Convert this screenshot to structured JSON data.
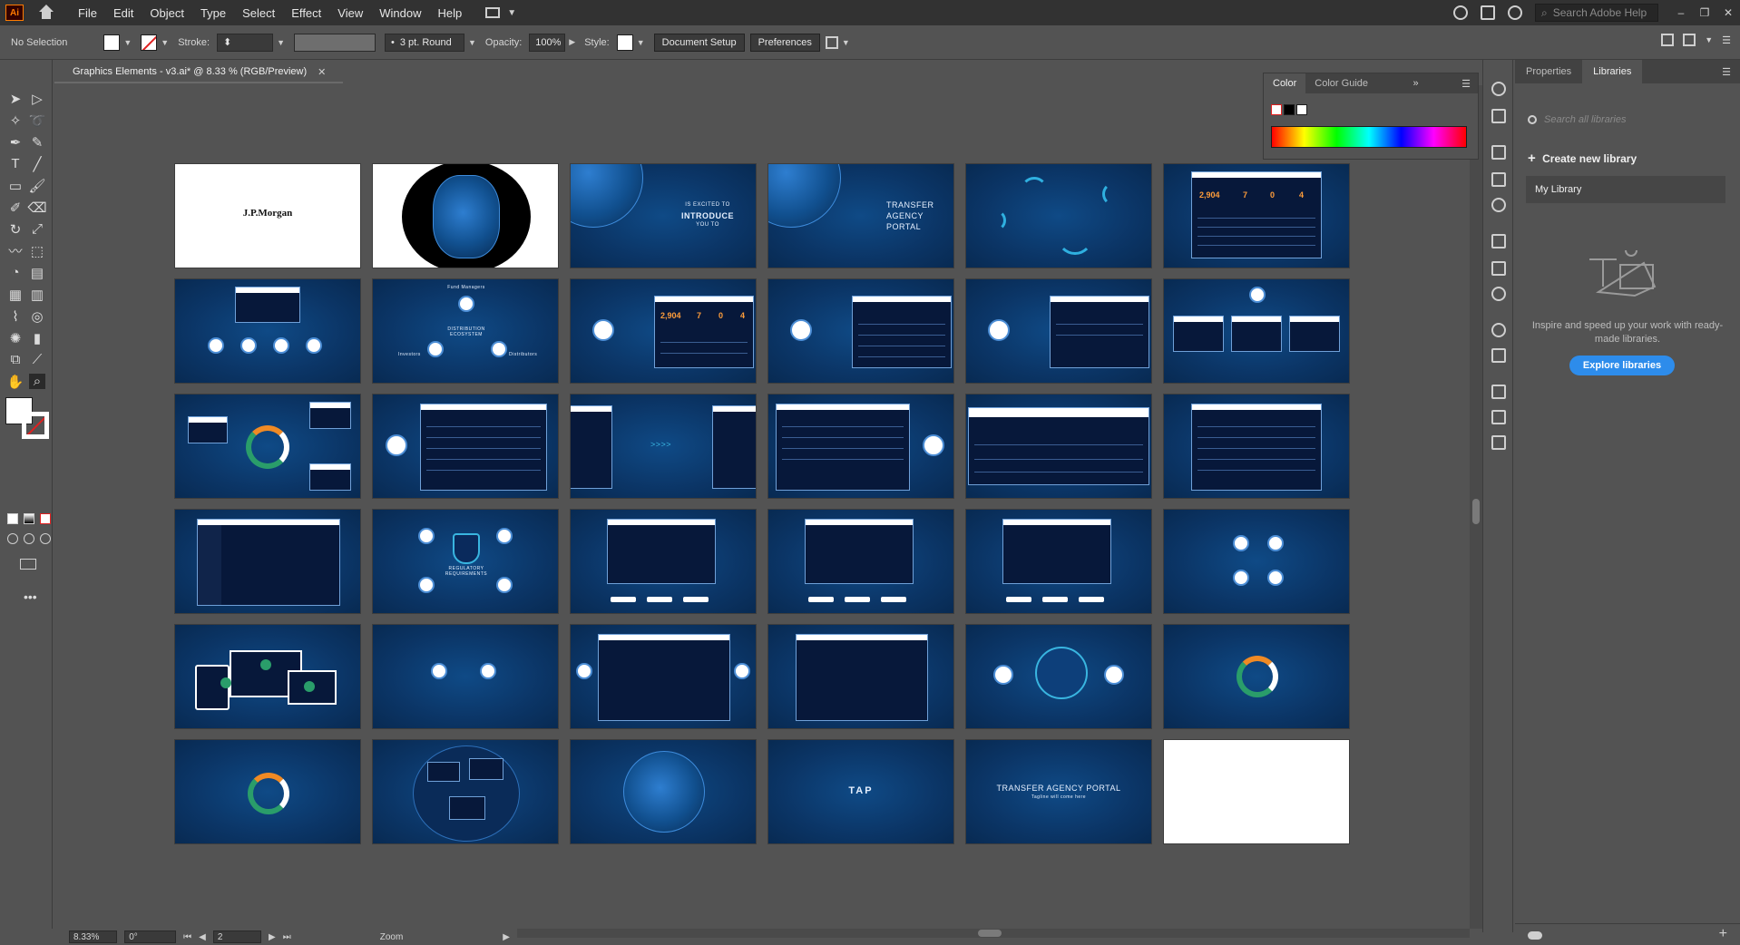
{
  "app": {
    "logo": "Ai",
    "menu": [
      "File",
      "Edit",
      "Object",
      "Type",
      "Select",
      "Effect",
      "View",
      "Window",
      "Help"
    ],
    "search_placeholder": "Search Adobe Help"
  },
  "control_bar": {
    "selection": "No Selection",
    "stroke_label": "Stroke:",
    "brush": "3 pt. Round",
    "opacity_label": "Opacity:",
    "opacity_value": "100%",
    "style_label": "Style:",
    "document_setup": "Document Setup",
    "preferences": "Preferences"
  },
  "document": {
    "tab_title": "Graphics Elements - v3.ai* @ 8.33 % (RGB/Preview)"
  },
  "artboards": {
    "logo_text": "J.P.Morgan",
    "intro_lines": [
      "IS EXCITED TO",
      "INTRODUCE",
      "YOU TO"
    ],
    "portal_lines": [
      "TRANSFER",
      "AGENCY",
      "PORTAL"
    ],
    "kpis": [
      "2,904",
      "7",
      "0",
      "4"
    ],
    "cycle_top": "Fund Managers",
    "cycle_center": "DISTRIBUTION ECOSYSTEM",
    "cycle_left": "Investors",
    "cycle_right": "Distributors",
    "reg_center": "REGULATORY REQUIREMENTS",
    "tap": "TAP",
    "portal_title": "TRANSFER AGENCY PORTAL",
    "portal_tagline": "Tagline will come here"
  },
  "status_bar": {
    "zoom": "8.33%",
    "rotation": "0°",
    "artboard_number": "2",
    "tool": "Zoom"
  },
  "color_panel": {
    "tabs": [
      "Color",
      "Color Guide"
    ]
  },
  "libraries_panel": {
    "tabs": [
      "Properties",
      "Libraries"
    ],
    "search_placeholder": "Search all libraries",
    "create_new": "Create new library",
    "my_library": "My Library",
    "promo": "Inspire and speed up your work with ready-made libraries.",
    "explore_button": "Explore libraries"
  },
  "colors": {
    "artboard_blue": "#0b3566",
    "accent_orange": "#f08a24",
    "accent_green": "#2a9d6a",
    "explore_blue": "#2d8ceb"
  }
}
